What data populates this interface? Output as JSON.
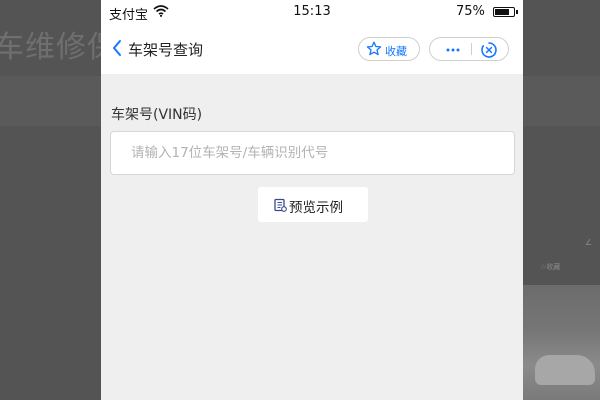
{
  "background": {
    "title_fragment": "车维修保",
    "right_edge_text": "∠",
    "right_star_text": "☆收藏"
  },
  "status_bar": {
    "carrier": "支付宝",
    "time": "15:13",
    "battery": "75%"
  },
  "nav": {
    "title": "车架号查询",
    "favorite_label": "收藏"
  },
  "form": {
    "vin_label": "车架号(VIN码)",
    "vin_value": "",
    "vin_placeholder": "请输入17位车架号/车辆识别代号",
    "preview_label": "预览示例"
  },
  "colors": {
    "accent": "#1677ff",
    "overlay": "#545454",
    "page_background": "#efefef"
  }
}
